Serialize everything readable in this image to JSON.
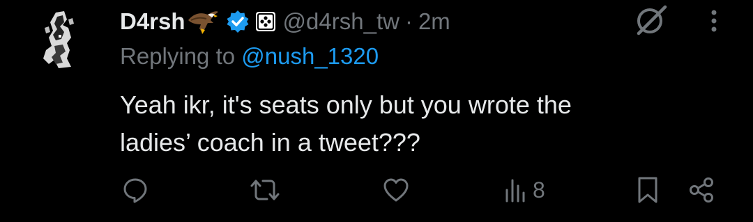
{
  "author": {
    "display_name": "D4rsh",
    "name_emoji": "eagle-emoji",
    "handle": "@d4rsh_tw",
    "separator": "·",
    "timestamp": "2m",
    "verified": true
  },
  "reply": {
    "prefix": "Replying to ",
    "mention": "@nush_1320"
  },
  "text": {
    "line1": "Yeah ikr, it's seats only but you wrote the",
    "line2": "ladies’ coach in a tweet???"
  },
  "actions": {
    "views_count": "8"
  },
  "icons": {
    "grok": "grok-icon",
    "more": "more-options-icon",
    "reply": "reply-icon",
    "retweet": "retweet-icon",
    "like": "like-icon",
    "views": "views-icon",
    "bookmark": "bookmark-icon",
    "share": "share-icon"
  },
  "colors": {
    "background": "#000000",
    "text_primary": "#e7e9ea",
    "text_secondary": "#71767b",
    "accent": "#1d9bf0"
  }
}
